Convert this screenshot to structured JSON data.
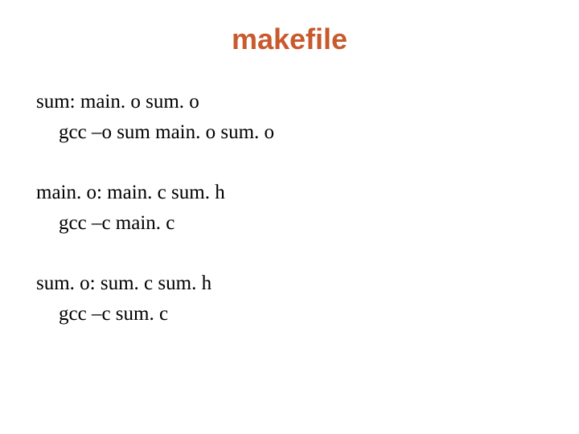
{
  "title": "makefile",
  "rules": [
    {
      "target": "sum: main. o sum. o",
      "command": "gcc –o sum main. o sum. o"
    },
    {
      "target": "main. o: main. c sum. h",
      "command": "gcc –c main. c"
    },
    {
      "target": "sum. o: sum. c sum. h",
      "command": "gcc –c sum. c"
    }
  ]
}
